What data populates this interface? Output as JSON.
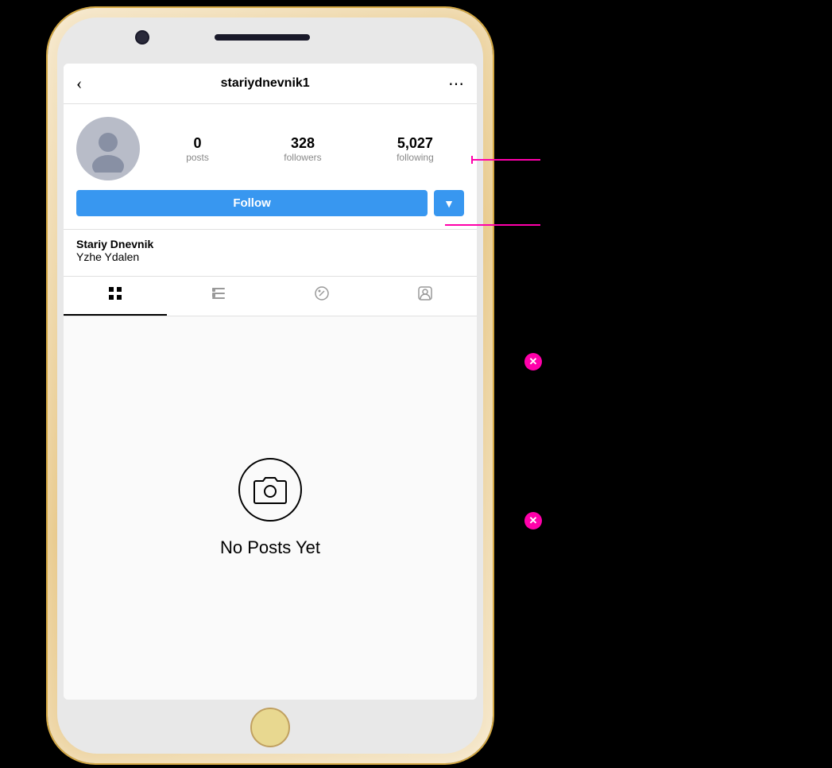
{
  "phone": {
    "header": {
      "back_label": "‹",
      "username": "stariydnevnik1",
      "more_icon": "⋯"
    },
    "profile": {
      "stats": [
        {
          "id": "posts",
          "count": "0",
          "label": "posts"
        },
        {
          "id": "followers",
          "count": "328",
          "label": "followers"
        },
        {
          "id": "following",
          "count": "5,027",
          "label": "following"
        }
      ],
      "follow_button_label": "Follow",
      "dropdown_icon": "▼",
      "bio_name": "Stariy Dnevnik",
      "bio_text": "Yzhe Ydalen"
    },
    "tabs": [
      {
        "id": "grid",
        "icon": "grid"
      },
      {
        "id": "list",
        "icon": "list"
      },
      {
        "id": "tag",
        "icon": "tag"
      },
      {
        "id": "person",
        "icon": "person"
      }
    ],
    "content": {
      "empty_icon": "camera",
      "empty_text": "No Posts Yet"
    }
  },
  "annotations": {
    "dot1_symbol": "✕",
    "dot2_symbol": "✕"
  }
}
